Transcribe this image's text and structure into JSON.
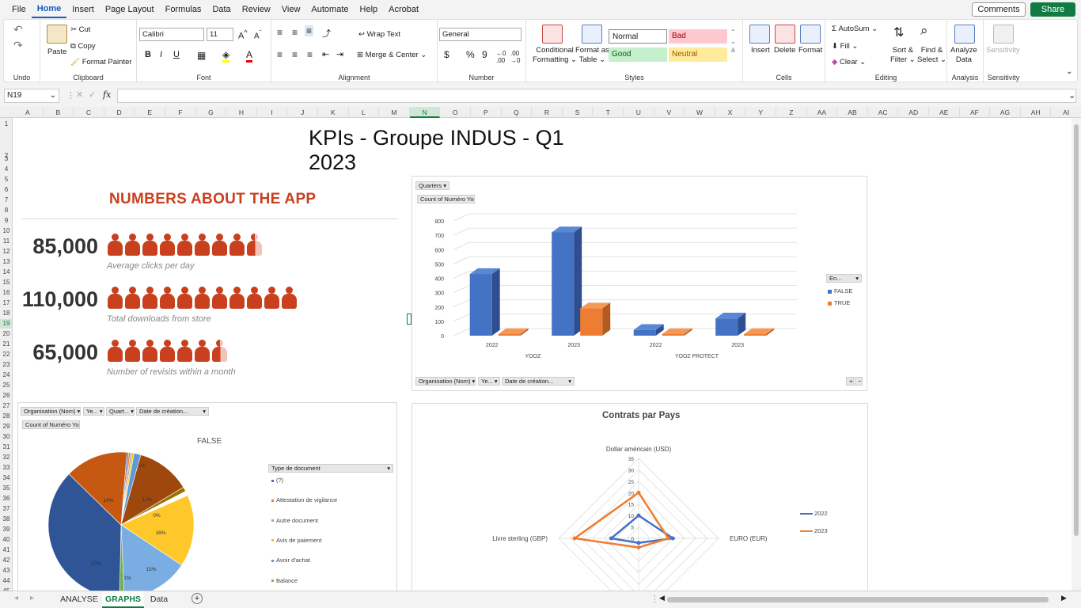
{
  "menu": {
    "items": [
      "File",
      "Home",
      "Insert",
      "Page Layout",
      "Formulas",
      "Data",
      "Review",
      "View",
      "Automate",
      "Help",
      "Acrobat"
    ],
    "active": "Home",
    "comments": "Comments",
    "share": "Share"
  },
  "ribbon": {
    "undo_label": "Undo",
    "clipboard": {
      "paste": "Paste",
      "cut": "Cut",
      "copy": "Copy",
      "format_painter": "Format Painter",
      "label": "Clipboard"
    },
    "font": {
      "name": "Calibri",
      "size": "11",
      "label": "Font"
    },
    "alignment": {
      "wrap_text": "Wrap Text",
      "merge_center": "Merge & Center",
      "label": "Alignment"
    },
    "number": {
      "format": "General",
      "label": "Number"
    },
    "styles": {
      "conditional": "Conditional",
      "formatting": "Formatting",
      "format_as": "Format as",
      "table": "Table",
      "normal": "Normal",
      "bad": "Bad",
      "good": "Good",
      "neutral": "Neutral",
      "label": "Styles"
    },
    "cells": {
      "insert": "Insert",
      "delete": "Delete",
      "format": "Format",
      "label": "Cells"
    },
    "editing": {
      "autosum": "AutoSum",
      "fill": "Fill",
      "clear": "Clear",
      "sort": "Sort &",
      "filter": "Filter",
      "find": "Find &",
      "select": "Select",
      "label": "Editing"
    },
    "analysis": {
      "analyze": "Analyze",
      "data": "Data",
      "label": "Analysis"
    },
    "sensitivity": {
      "btn": "Sensitivity",
      "label": "Sensitivity"
    }
  },
  "formula_bar": {
    "name_box": "N19",
    "fx": "fx",
    "content": ""
  },
  "columns": [
    "A",
    "B",
    "C",
    "D",
    "E",
    "F",
    "G",
    "H",
    "I",
    "J",
    "K",
    "L",
    "M",
    "N",
    "O",
    "P",
    "Q",
    "R",
    "S",
    "T",
    "U",
    "V",
    "W",
    "X",
    "Y",
    "Z",
    "AA",
    "AB",
    "AC",
    "AD",
    "AE",
    "AF",
    "AG",
    "AH",
    "AI"
  ],
  "selected_column": "N",
  "selected_row": "19",
  "rows": [
    "1",
    "2",
    "3",
    "4",
    "5",
    "6",
    "7",
    "8",
    "9",
    "10",
    "11",
    "12",
    "13",
    "14",
    "15",
    "16",
    "17",
    "18",
    "19",
    "20",
    "21",
    "22",
    "23",
    "24",
    "25",
    "26",
    "27",
    "28",
    "29",
    "30",
    "31",
    "32",
    "33",
    "34",
    "35",
    "36",
    "37",
    "38",
    "39",
    "40",
    "41",
    "42",
    "43",
    "44",
    "45"
  ],
  "dashboard": {
    "title": "KPIs - Groupe INDUS - Q1 2023",
    "app_heading": "NUMBERS ABOUT THE APP",
    "kpis": [
      {
        "value": "85,000",
        "caption": "Average clicks per day",
        "icons": 8.6
      },
      {
        "value": "110,000",
        "caption": "Total downloads from store",
        "icons": 11
      },
      {
        "value": "65,000",
        "caption": "Number of revisits within a month",
        "icons": 6.5
      }
    ]
  },
  "bar_panel": {
    "filter_quarters": "Quarters",
    "value_label": "Count of Numéro Yooz",
    "legend_filter": "En...",
    "filters_bottom": [
      "Organisation (Nom)",
      "Ye...",
      "Date de création..."
    ],
    "zoom_buttons": [
      "+",
      "−"
    ]
  },
  "pie_panel": {
    "filters": [
      "Organisation (Nom)",
      "Ye...",
      "Quart...",
      "Date de création..."
    ],
    "value_label": "Count of Numéro Yooz",
    "legend_title": "Type de document"
  },
  "radar_panel": {},
  "sheet_tabs": [
    "ANALYSE",
    "GRAPHS",
    "Data"
  ],
  "active_tab": "GRAPHS",
  "chart_data": [
    {
      "type": "bar",
      "title": "",
      "categories": [
        "2022",
        "2023",
        "2022",
        "2023"
      ],
      "groups": [
        "YOOZ",
        "YOOZ",
        "YOOZ PROTECT",
        "YOOZ PROTECT"
      ],
      "series": [
        {
          "name": "FALSE",
          "values": [
            430,
            720,
            40,
            120
          ],
          "color": "#4472c4"
        },
        {
          "name": "TRUE",
          "values": [
            0,
            190,
            0,
            0
          ],
          "color": "#ed7d31"
        }
      ],
      "ylim": [
        0,
        800
      ],
      "yticks": [
        "0",
        "100",
        "200",
        "300",
        "400",
        "500",
        "600",
        "700",
        "800"
      ],
      "legend": "right"
    },
    {
      "type": "pie",
      "title": "FALSE",
      "slices": [
        {
          "label": "(?)",
          "value": 0.4,
          "color": "#4472c4"
        },
        {
          "label": "Attestation de vigilance",
          "value": 0.4,
          "color": "#ed7d31"
        },
        {
          "label": "Autre document",
          "value": 0.4,
          "color": "#a5a5a5"
        },
        {
          "label": "Avis de paiement",
          "value": 0.4,
          "color": "#ffc000"
        },
        {
          "label": "Avoir d'achat",
          "value": 1.5,
          "color": "#5b9bd5"
        },
        {
          "label": "",
          "value": 12,
          "color": "#9e480e"
        },
        {
          "label": "",
          "value": 1,
          "color": "#997300"
        },
        {
          "label": "",
          "value": 1,
          "color": "#ffffff"
        },
        {
          "label": "",
          "value": 16,
          "color": "#ffc82a"
        },
        {
          "label": "",
          "value": 15,
          "color": "#7aaee3"
        },
        {
          "label": "",
          "value": 1,
          "color": "#70ad47"
        },
        {
          "label": "",
          "value": 37,
          "color": "#2f5597"
        },
        {
          "label": "",
          "value": 14,
          "color": "#c65911"
        }
      ],
      "data_labels": [
        "1%",
        "12%",
        "0%",
        "16%",
        "15%",
        "1%",
        "37%",
        "14%"
      ],
      "legend_items": [
        "(?)",
        "Attestation de vigilance",
        "Autre document",
        "Avis de paiement",
        "Avoir d'achat",
        "Balance"
      ],
      "legend_colors": [
        "#4472c4",
        "#ed7d31",
        "#a5a5a5",
        "#ffc000",
        "#5b9bd5",
        "#c09a3a"
      ]
    },
    {
      "type": "radar",
      "title": "Contrats par Pays",
      "axes": [
        "Dollar américain (USD)",
        "EURO (EUR)",
        "",
        "Livre sterling (GBP)"
      ],
      "rticks": [
        "0",
        "5",
        "10",
        "15",
        "20",
        "25",
        "30",
        "35"
      ],
      "rlim": [
        0,
        35
      ],
      "series": [
        {
          "name": "2022",
          "values": [
            10,
            15,
            2,
            12
          ],
          "color": "#4472c4"
        },
        {
          "name": "2023",
          "values": [
            20,
            13,
            4,
            28
          ],
          "color": "#ed7d31"
        }
      ],
      "legend": "right"
    }
  ]
}
